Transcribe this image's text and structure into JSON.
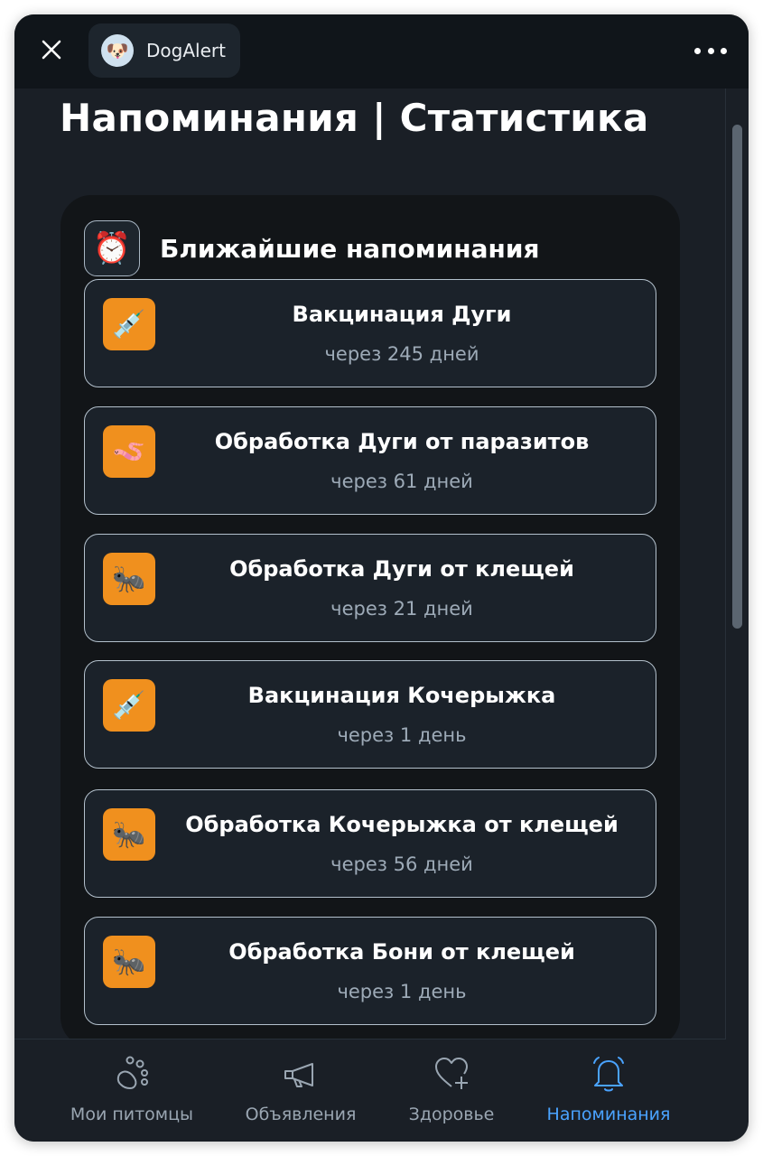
{
  "window": {
    "app_name": "DogAlert",
    "app_avatar_icon": "dog-face-icon",
    "accent_color": "#4aa3ff",
    "reminder_icon_bg": "#f0901e"
  },
  "page": {
    "title": "Напоминания | Статистика"
  },
  "section": {
    "icon": "alarm-clock-icon",
    "title": "Ближайшие напоминания"
  },
  "reminders": [
    {
      "icon": "syringe-icon",
      "glyph": "💉",
      "title": "Вакцинация Дуги",
      "due": "через 245 дней"
    },
    {
      "icon": "worm-icon",
      "glyph": "🪱",
      "title": "Обработка Дуги от паразитов",
      "due": "через 61 дней"
    },
    {
      "icon": "ant-icon",
      "glyph": "🐜",
      "title": "Обработка Дуги от клещей",
      "due": "через 21 дней"
    },
    {
      "icon": "syringe-icon",
      "glyph": "💉",
      "title": "Вакцинация Кочерыжка",
      "due": "через 1 день"
    },
    {
      "icon": "ant-icon",
      "glyph": "🐜",
      "title": "Обработка Кочерыжка от клещей",
      "due": "через 56 дней"
    },
    {
      "icon": "ant-icon",
      "glyph": "🐜",
      "title": "Обработка Бони от клещей",
      "due": "через 1 день"
    }
  ],
  "nav": {
    "items": [
      {
        "icon": "paw-icon",
        "label": "Мои питомцы",
        "active": false
      },
      {
        "icon": "megaphone-icon",
        "label": "Объявления",
        "active": false
      },
      {
        "icon": "heart-plus-icon",
        "label": "Здоровье",
        "active": false
      },
      {
        "icon": "bell-icon",
        "label": "Напоминания",
        "active": true
      }
    ]
  }
}
